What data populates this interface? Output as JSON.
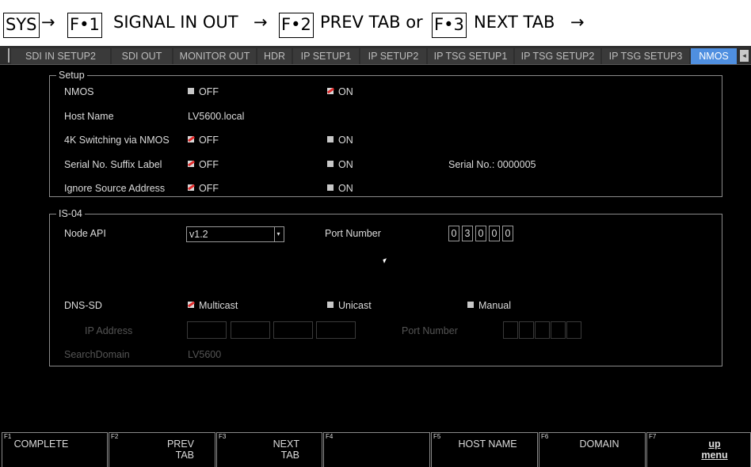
{
  "instruction": {
    "keys": [
      "SYS",
      "F•1",
      "F•2",
      "F•3"
    ],
    "arrow": "→",
    "step1_text": "SIGNAL IN OUT",
    "step2_text": "PREV TAB or",
    "step3_text": "NEXT TAB"
  },
  "tabs": [
    {
      "label": "SDI IN SETUP2",
      "active": false
    },
    {
      "label": "SDI OUT",
      "active": false
    },
    {
      "label": "MONITOR OUT",
      "active": false
    },
    {
      "label": "HDR",
      "active": false
    },
    {
      "label": "IP SETUP1",
      "active": false
    },
    {
      "label": "IP SETUP2",
      "active": false
    },
    {
      "label": "IP TSG SETUP1",
      "active": false
    },
    {
      "label": "IP TSG SETUP2",
      "active": false
    },
    {
      "label": "IP TSG SETUP3",
      "active": false
    },
    {
      "label": "NMOS",
      "active": true
    }
  ],
  "tab_scroll_glyph": "◂",
  "setup": {
    "title": "Setup",
    "nmos_label": "NMOS",
    "nmos_off": "OFF",
    "nmos_on": "ON",
    "host_name_label": "Host Name",
    "host_name_value": "LV5600.local",
    "k4_label": "4K Switching via NMOS",
    "k4_off": "OFF",
    "k4_on": "ON",
    "serial_label": "Serial No. Suffix Label",
    "serial_off": "OFF",
    "serial_on": "ON",
    "serial_no_text": "Serial No.: 0000005",
    "ignore_label": "Ignore Source Address",
    "ignore_off": "OFF",
    "ignore_on": "ON"
  },
  "is04": {
    "title": "IS-04",
    "node_api_label": "Node API",
    "node_api_value": "v1.2",
    "port_label": "Port Number",
    "port_digits": [
      "0",
      "3",
      "0",
      "0",
      "0"
    ],
    "dns_label": "DNS-SD",
    "dns_multicast": "Multicast",
    "dns_unicast": "Unicast",
    "dns_manual": "Manual",
    "ip_address_label": "IP Address",
    "port_number_dim_label": "Port Number",
    "search_domain_label": "SearchDomain",
    "search_domain_value": "LV5600"
  },
  "fkeys": [
    {
      "num": "F1",
      "label": "COMPLETE"
    },
    {
      "num": "F2",
      "label": "PREV\nTAB"
    },
    {
      "num": "F3",
      "label": "NEXT\nTAB"
    },
    {
      "num": "F4",
      "label": ""
    },
    {
      "num": "F5",
      "label": "HOST NAME"
    },
    {
      "num": "F6",
      "label": "DOMAIN"
    },
    {
      "num": "F7",
      "label": "up\nmenu"
    }
  ],
  "colors": {
    "active_tab": "#4f8fe0",
    "screen_bg": "#000000",
    "checked_mark": "#e02a2a"
  }
}
